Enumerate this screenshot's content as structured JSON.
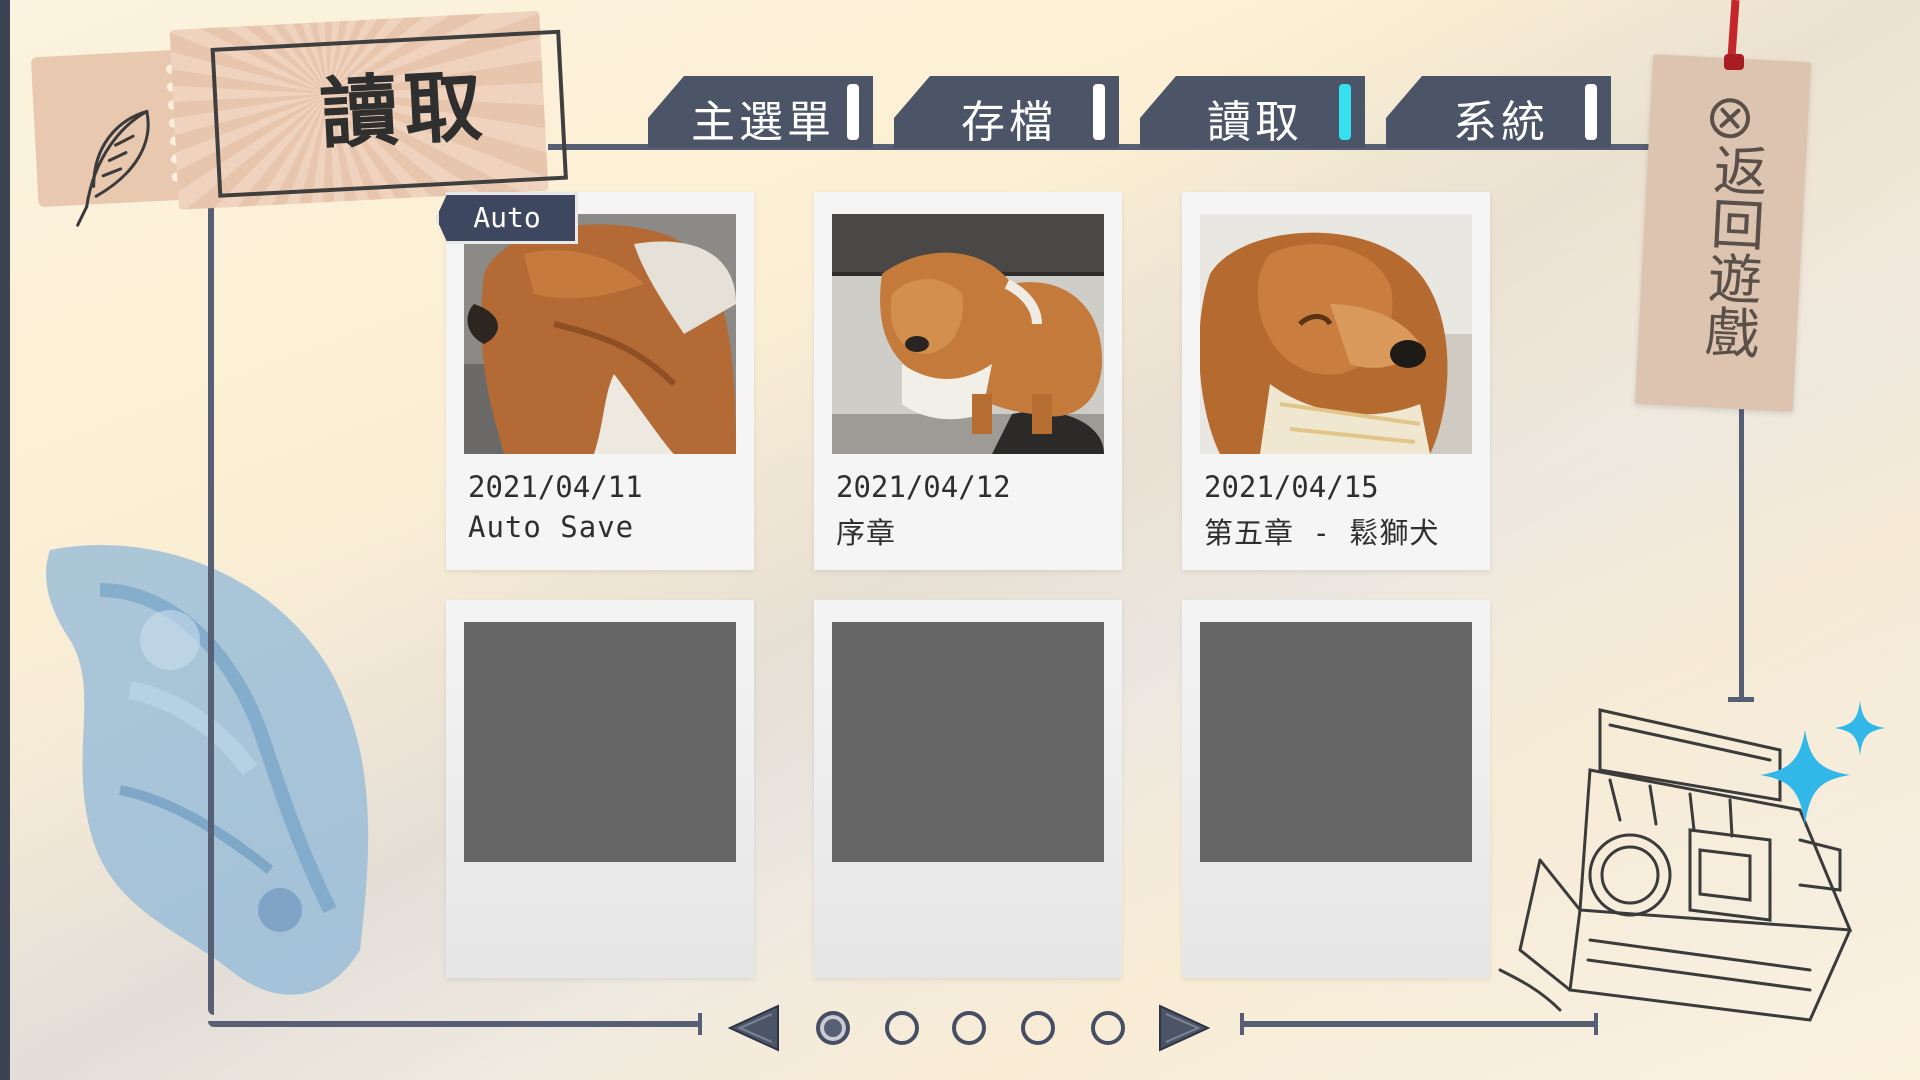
{
  "header": {
    "title": "讀取"
  },
  "tabs": [
    {
      "label": "主選單",
      "active": false
    },
    {
      "label": "存檔",
      "active": false
    },
    {
      "label": "讀取",
      "active": true
    },
    {
      "label": "系統",
      "active": false
    }
  ],
  "return_button": {
    "label": "返回遊戲",
    "icon": "close-circle-icon"
  },
  "slots": [
    {
      "badge": "Auto",
      "date": "2021/04/11",
      "description": "Auto Save",
      "thumbnail": "dog-side-profile"
    },
    {
      "date": "2021/04/12",
      "description": "序章",
      "thumbnail": "dog-standing"
    },
    {
      "date": "2021/04/15",
      "description": "第五章 - 鬆獅犬",
      "thumbnail": "dog-close-up"
    },
    {
      "empty": true
    },
    {
      "empty": true
    },
    {
      "empty": true
    }
  ],
  "pagination": {
    "pages": 5,
    "current": 1
  },
  "colors": {
    "frame": "#575f74",
    "tab_bg": "#4c5468",
    "tab_active_marker": "#35e0ef",
    "empty_thumb": "#666666",
    "return_string": "#c3272b"
  }
}
